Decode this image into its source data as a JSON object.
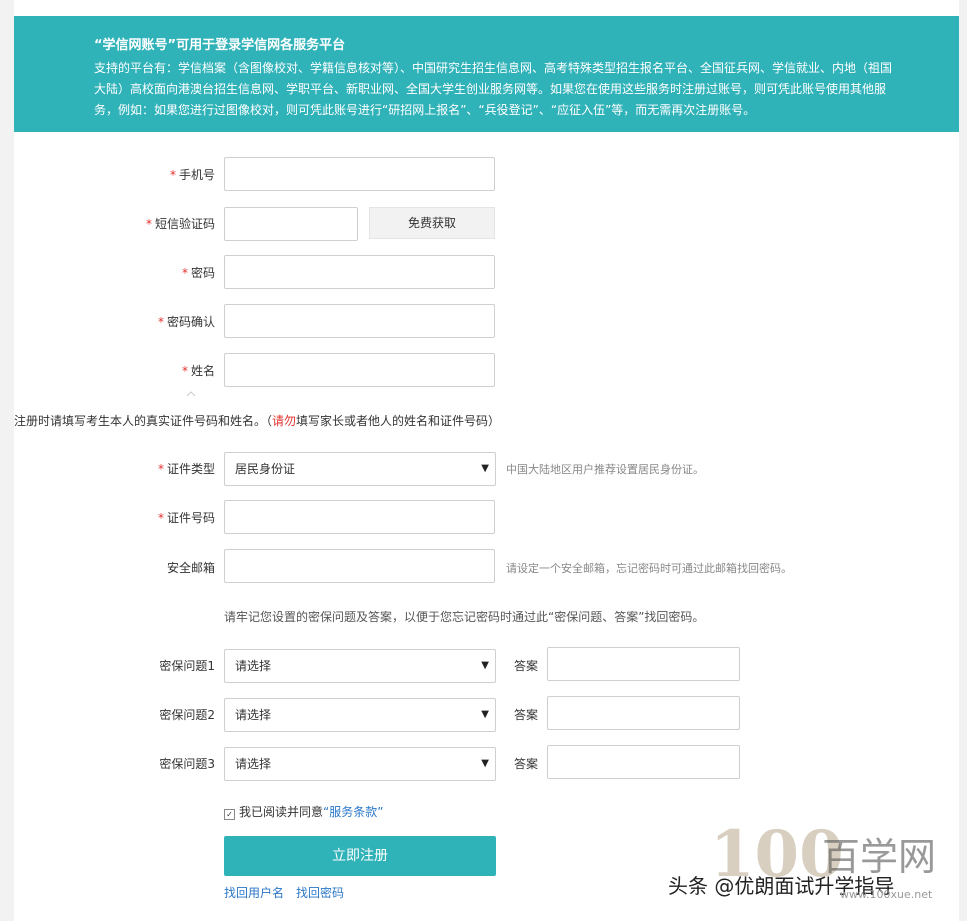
{
  "banner": {
    "title": "“学信网账号”可用于登录学信网各服务平台",
    "text": "支持的平台有：学信档案（含图像校对、学籍信息核对等）、中国研究生招生信息网、高考特殊类型招生报名平台、全国征兵网、学信就业、内地（祖国大陆）高校面向港澳台招生信息网、学职平台、新职业网、全国大学生创业服务网等。如果您在使用这些服务时注册过账号，则可凭此账号使用其他服务，例如：如果您进行过图像校对，则可凭此账号进行“研招网上报名”、“兵役登记”、“应征入伍”等，而无需再次注册账号。"
  },
  "form": {
    "required_mark": "*",
    "phone_label": "手机号",
    "sms_label": "短信验证码",
    "sms_button": "免费获取",
    "password_label": "密码",
    "confirm_label": "密码确认",
    "name_label": "姓名",
    "notice_pre": "注册时请填写考生本人的真实证件号码和姓名。（",
    "notice_red": "请勿",
    "notice_post": "填写家长或者他人的姓名和证件号码）",
    "id_type_label": "证件类型",
    "id_type_value": "居民身份证",
    "id_type_hint": "中国大陆地区用户推荐设置居民身份证。",
    "id_number_label": "证件号码",
    "email_label": "安全邮箱",
    "email_hint": "请设定一个安全邮箱，忘记密码时可通过此邮箱找回密码。",
    "security_notice": "请牢记您设置的密保问题及答案，以便于您忘记密码时通过此“密保问题、答案”找回密码。",
    "questions": [
      {
        "label": "密保问题1",
        "value": "请选择",
        "answer_label": "答案"
      },
      {
        "label": "密保问题2",
        "value": "请选择",
        "answer_label": "答案"
      },
      {
        "label": "密保问题3",
        "value": "请选择",
        "answer_label": "答案"
      }
    ],
    "agree_pre": "我已阅读并同意",
    "agree_link": "“服务条款”",
    "submit": "立即注册",
    "find_user": "找回用户名",
    "find_password": "找回密码"
  },
  "watermark": {
    "brand": "百学网",
    "caption": "头条 @优朗面试升学指导",
    "url": "www.100xue.net"
  },
  "icons": {
    "caret": "caret-down-icon",
    "checkbox": "checkbox-checked-icon"
  },
  "colors": {
    "accent": "#30b2b9",
    "required": "#e0332e",
    "link": "#2a77c9"
  }
}
